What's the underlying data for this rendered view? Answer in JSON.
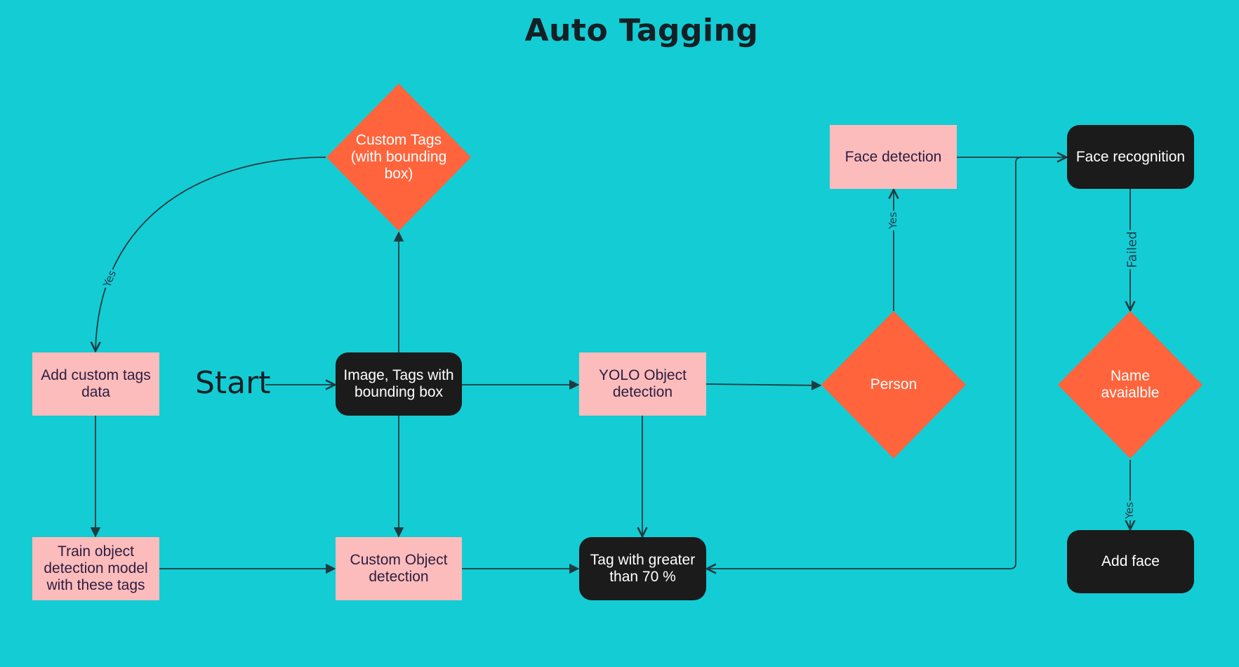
{
  "title": "Auto Tagging",
  "start_label": "Start",
  "colors": {
    "background": "#14ccd4",
    "process": "#fdbcbc",
    "terminal": "#1b1b1b",
    "decision": "#ff643c",
    "edge": "#1e3b40"
  },
  "nodes": {
    "custom_tags_decision": "Custom Tags (with bounding box)",
    "add_custom_tags": "Add custom tags data",
    "image_tags": "Image, Tags with bounding box",
    "yolo": "YOLO Object detection",
    "person_decision": "Person",
    "face_detection": "Face detection",
    "face_recognition": "Face recognition",
    "name_available_decision": "Name avaialble",
    "add_face": "Add face",
    "train_model": "Train object detection model with these tags",
    "custom_object_detection": "Custom Object detection",
    "tag_threshold": "Tag with greater than 70 %"
  },
  "edge_labels": {
    "custom_tags_yes": "Yes",
    "person_yes": "Yes",
    "recognition_failed": "Failed",
    "name_yes": "Yes"
  }
}
